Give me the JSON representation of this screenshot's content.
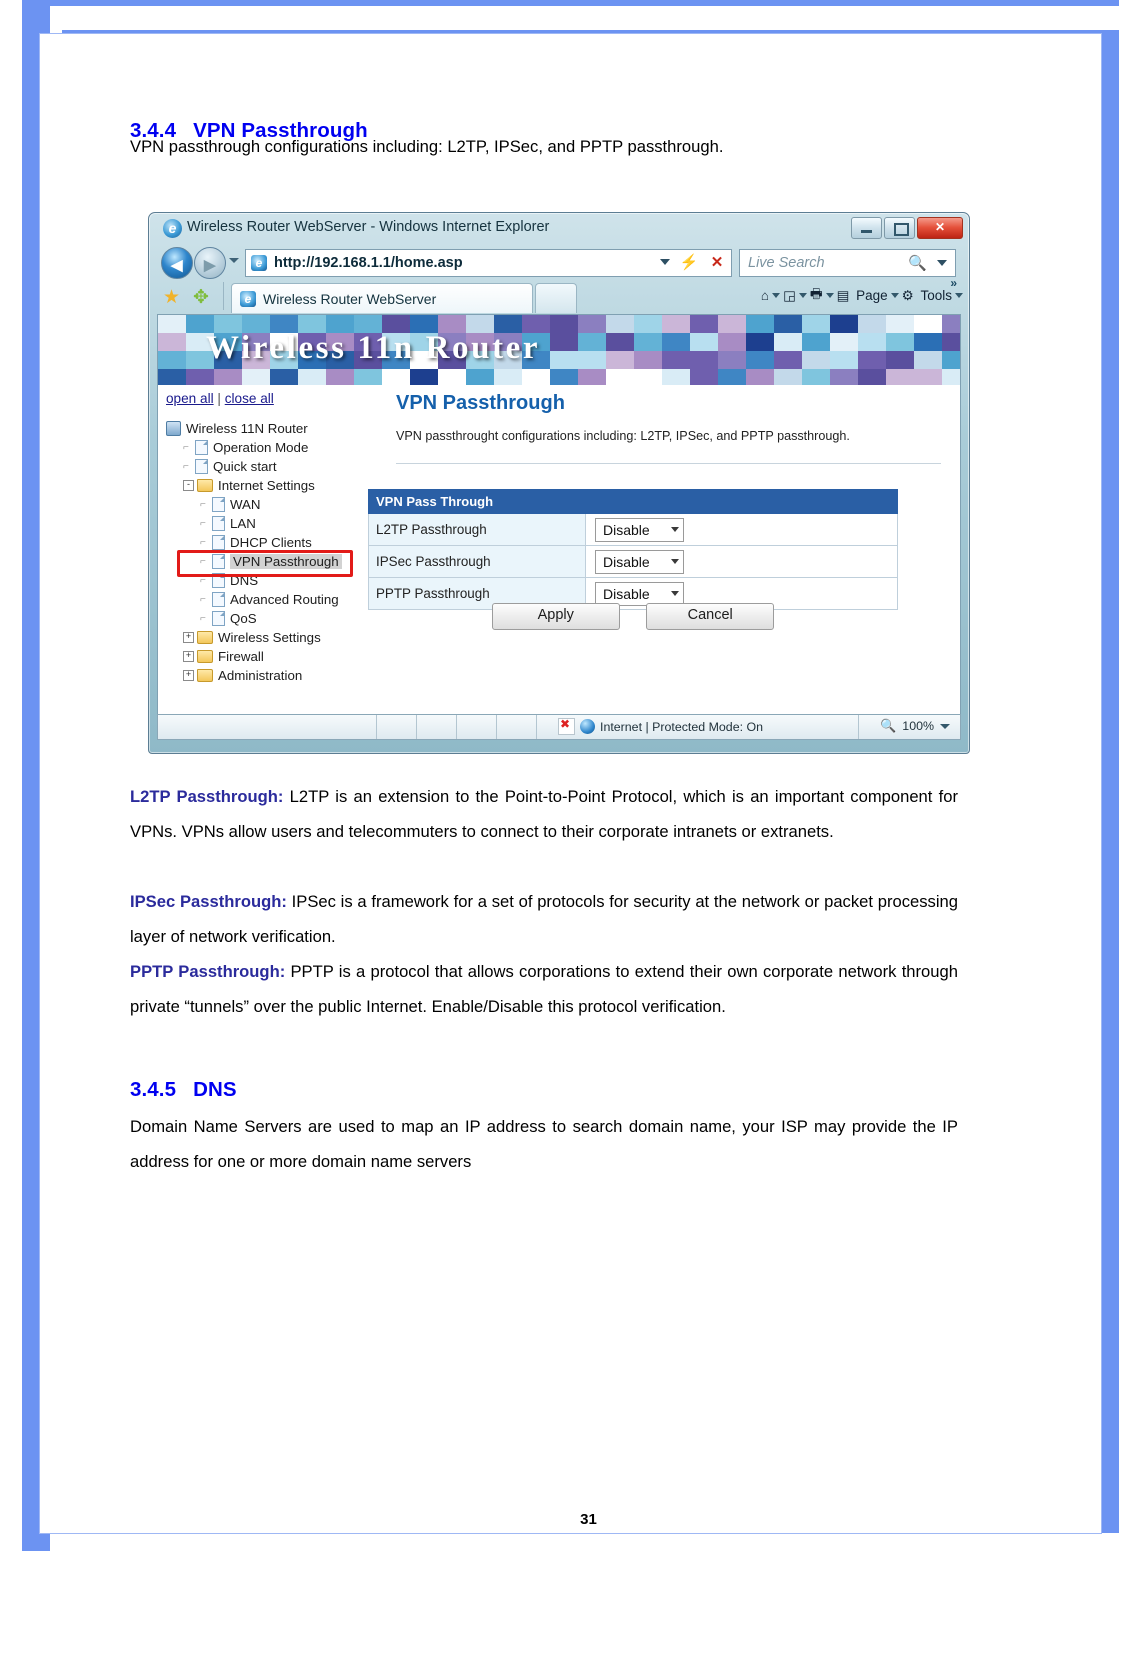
{
  "document": {
    "section1": {
      "number": "3.4.4",
      "title": "VPN Passthrough"
    },
    "intro": "VPN passthrough configurations including: L2TP, IPSec, and PPTP passthrough.",
    "paragraphs": [
      {
        "label": "L2TP Passthrough:",
        "text": " L2TP is an extension to the Point-to-Point Protocol, which is an important component for VPNs. VPNs allow users and telecommuters to connect to their corporate intranets or extranets."
      },
      {
        "label": "IPSec Passthrough:",
        "text": " IPSec is a framework for a set of protocols for security at the network or packet processing layer of network verification."
      },
      {
        "label": "PPTP Passthrough:",
        "text": " PPTP is a protocol that allows corporations to extend their own corporate network through private “tunnels” over the public Internet. Enable/Disable this protocol verification."
      }
    ],
    "section2": {
      "number": "3.4.5",
      "title": "DNS"
    },
    "section2_body": "Domain Name Servers are used to map an IP address to search domain name, your ISP may provide the IP address for one or more domain name servers",
    "page_number": "31"
  },
  "browser": {
    "window_title": "Wireless Router WebServer - Windows Internet Explorer",
    "window_buttons": {
      "minimize": "minimize-button",
      "maximize": "maximize-button",
      "close": "✕"
    },
    "address_url": "http://192.168.1.1/home.asp",
    "refresh_glyph": "⚡",
    "stop_glyph": "✕",
    "search_placeholder": "Live Search",
    "search_glyph": "🔍",
    "tab_label": "Wireless Router WebServer",
    "command_bar": [
      {
        "icon": "home-icon",
        "glyph": "⌂",
        "label": ""
      },
      {
        "icon": "feeds-icon",
        "glyph": "📶",
        "label": ""
      },
      {
        "icon": "print-icon",
        "glyph": "🖶",
        "label": ""
      },
      {
        "icon": "page-icon",
        "glyph": "▤",
        "label": "Page"
      },
      {
        "icon": "tools-icon",
        "glyph": "⚙",
        "label": "Tools"
      }
    ],
    "overflow_glyph": "»",
    "status": {
      "zone_text": "Internet | Protected Mode: On",
      "zoom_level": "100%"
    }
  },
  "router": {
    "banner_title": "Wireless 11n Router",
    "links": {
      "open_all": "open all",
      "separator": "|",
      "close_all": "close all"
    },
    "tree": [
      {
        "label": "Wireless 11N Router",
        "icon": "computer-icon",
        "indent": 0,
        "expander": ""
      },
      {
        "label": "Operation Mode",
        "icon": "page-icon",
        "indent": 1,
        "expander": ""
      },
      {
        "label": "Quick start",
        "icon": "page-icon",
        "indent": 1,
        "expander": ""
      },
      {
        "label": "Internet Settings",
        "icon": "folder-icon",
        "indent": 1,
        "expander": "-"
      },
      {
        "label": "WAN",
        "icon": "page-icon",
        "indent": 2,
        "expander": ""
      },
      {
        "label": "LAN",
        "icon": "page-icon",
        "indent": 2,
        "expander": ""
      },
      {
        "label": "DHCP Clients",
        "icon": "page-icon",
        "indent": 2,
        "expander": ""
      },
      {
        "label": "VPN Passthrough",
        "icon": "page-icon",
        "indent": 2,
        "expander": "",
        "selected": true
      },
      {
        "label": "DNS",
        "icon": "page-icon",
        "indent": 2,
        "expander": ""
      },
      {
        "label": "Advanced Routing",
        "icon": "page-icon",
        "indent": 2,
        "expander": ""
      },
      {
        "label": "QoS",
        "icon": "page-icon",
        "indent": 2,
        "expander": ""
      },
      {
        "label": "Wireless Settings",
        "icon": "folder-icon",
        "indent": 1,
        "expander": "+"
      },
      {
        "label": "Firewall",
        "icon": "folder-icon",
        "indent": 1,
        "expander": "+"
      },
      {
        "label": "Administration",
        "icon": "folder-icon",
        "indent": 1,
        "expander": "+"
      }
    ],
    "content": {
      "title": "VPN Passthrough",
      "description": "VPN passthrought configurations including: L2TP, IPSec, and PPTP passthrough.",
      "table_header": "VPN Pass Through",
      "rows": [
        {
          "label": "L2TP Passthrough",
          "value": "Disable"
        },
        {
          "label": "IPSec Passthrough",
          "value": "Disable"
        },
        {
          "label": "PPTP Passthrough",
          "value": "Disable"
        }
      ],
      "apply_label": "Apply",
      "cancel_label": "Cancel"
    }
  },
  "colors": {
    "heading_blue": "#0000f0",
    "label_blue": "#2b2b9c",
    "table_header_blue": "#2a5fa5",
    "router_title_blue": "#1560ab",
    "highlight_red": "#e21b18",
    "page_border_blue": "#6c93f2"
  }
}
